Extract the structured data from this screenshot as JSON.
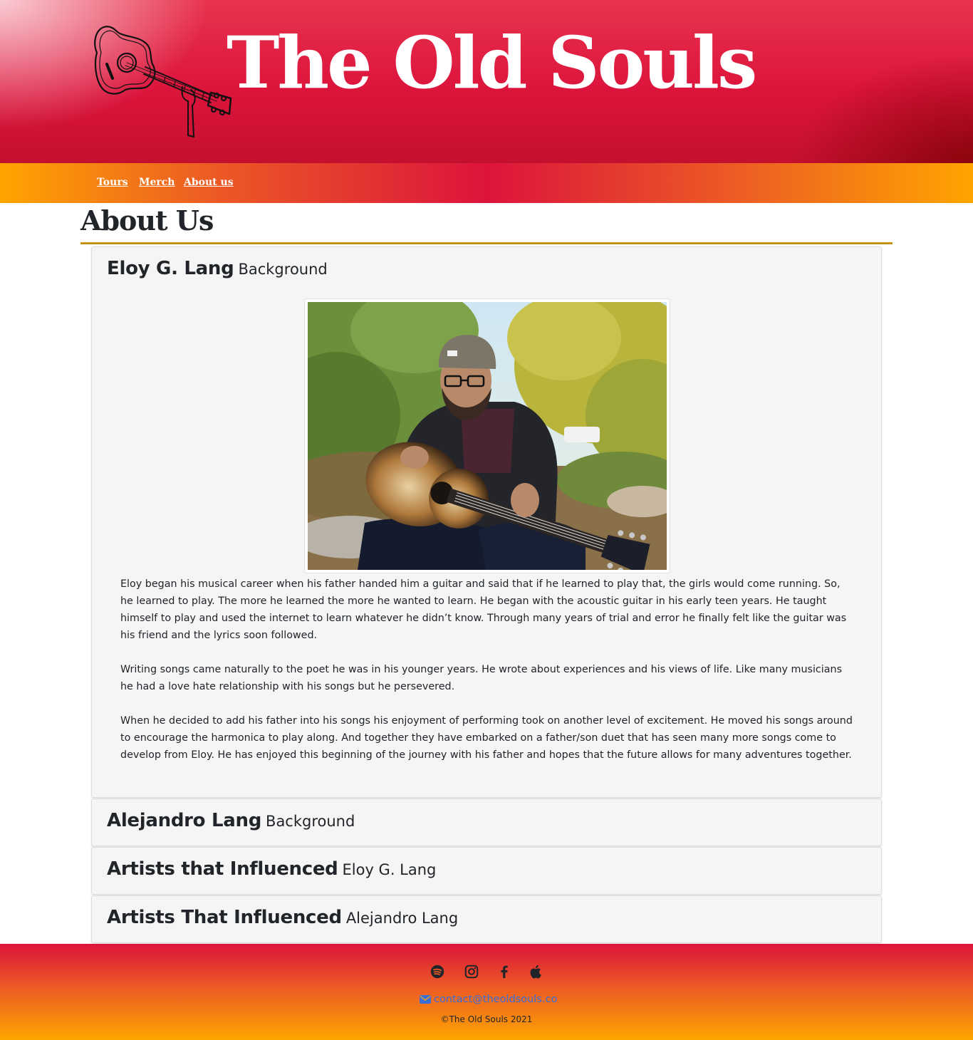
{
  "header": {
    "title": "The Old Souls",
    "logo_icon": "acoustic-guitar-icon"
  },
  "nav": {
    "items": [
      {
        "label": "Tours"
      },
      {
        "label": "Merch"
      },
      {
        "label": "About us"
      }
    ]
  },
  "main": {
    "heading": "About Us",
    "panels": [
      {
        "title": "Eloy G. Lang",
        "subtitle": "Background",
        "expanded": true,
        "photo_description": "man-with-acoustic-guitar-photo",
        "paragraphs": [
          "Eloy began his musical career when his father handed him a guitar and said that if he learned to play that, the girls would come running. So, he learned to play. The more he learned the more he wanted to learn. He began with the acoustic guitar in his early teen years. He taught himself to play and used the internet to learn whatever he didn’t know. Through many years of trial and error he finally felt like the guitar was his friend and the lyrics soon followed.",
          "Writing songs came naturally to the poet he was in his younger years. He wrote about experiences and his views of life. Like many musicians he had a love hate relationship with his songs but he persevered.",
          "When he decided to add his father into his songs his enjoyment of performing took on another level of excitement. He moved his songs around to encourage the harmonica to play along. And together they have embarked on a father/son duet that has seen many more songs come to develop from Eloy. He has enjoyed this beginning of the journey with his father and hopes that the future allows for many adventures together."
        ]
      },
      {
        "title": "Alejandro Lang",
        "subtitle": "Background",
        "expanded": false
      },
      {
        "title": "Artists that Influenced",
        "subtitle": "Eloy G. Lang",
        "expanded": false
      },
      {
        "title": "Artists That Influenced",
        "subtitle": "Alejandro Lang",
        "expanded": false
      }
    ]
  },
  "footer": {
    "social_icons": [
      "spotify-icon",
      "instagram-icon",
      "facebook-icon",
      "apple-icon"
    ],
    "email": "contact@theoldsouls.co",
    "copyright": "©The Old Souls 2021",
    "link_color": "#3b6dd6"
  },
  "colors": {
    "header_red": "#dc143c",
    "nav_orange": "#ffa500",
    "panel_bg": "#f5f5f5",
    "rule_gold": "#b8860b"
  }
}
